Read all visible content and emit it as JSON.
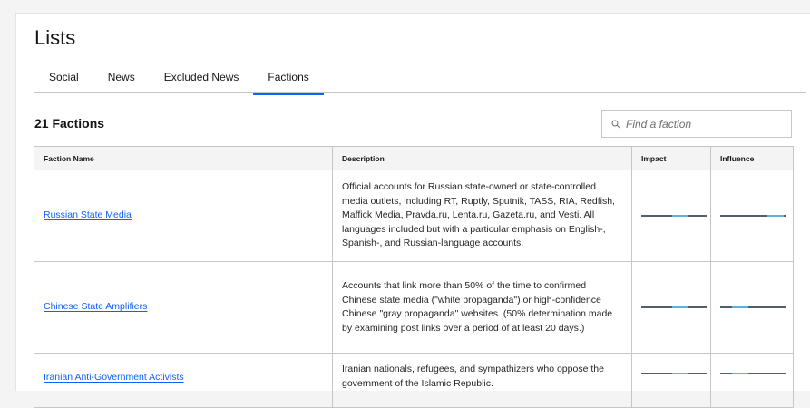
{
  "page": {
    "title": "Lists"
  },
  "tabs": [
    {
      "label": "Social",
      "active": false
    },
    {
      "label": "News",
      "active": false
    },
    {
      "label": "Excluded News",
      "active": false
    },
    {
      "label": "Factions",
      "active": true
    }
  ],
  "factions_section": {
    "count_label": "21 Factions",
    "search_placeholder": "Find a faction"
  },
  "table": {
    "headers": [
      "Faction Name",
      "Description",
      "Impact",
      "Influence"
    ],
    "rows": [
      {
        "name": "Russian State Media",
        "description": "Official accounts for Russian state-owned or state-controlled media outlets, including RT, Ruptly, Sputnik, TASS, RIA, Redfish, Maffick Media, Pravda.ru, Lenta.ru, Gazeta.ru, and Vesti. All languages included but with a particular emphasis on English-, Spanish-, and Russian-language accounts.",
        "impact_level": 0.6,
        "influence_level": 0.85
      },
      {
        "name": "Chinese State Amplifiers",
        "description": "Accounts that link more than 50% of the time to confirmed Chinese state media (\"white propaganda\") or high-confidence Chinese \"gray propaganda\" websites. (50% determination made by examining post links over a period of at least 20 days.)",
        "impact_level": 0.6,
        "influence_level": 0.3
      },
      {
        "name": "Iranian Anti-Government Activists",
        "description": "Iranian nationals, refugees, and sympathizers who oppose the government of the Islamic Republic.",
        "impact_level": 0.6,
        "influence_level": 0.3
      }
    ]
  },
  "colors": {
    "accent": "#0f62fe",
    "bar_dark": "#525e6a",
    "bar_light": "#5bb4d8"
  }
}
